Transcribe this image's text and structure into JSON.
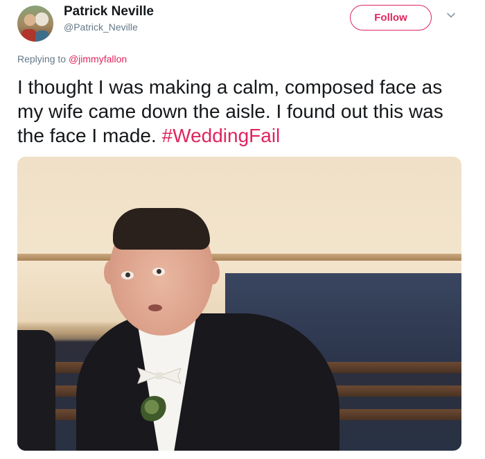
{
  "author": {
    "name": "Patrick Neville",
    "handle": "@Patrick_Neville"
  },
  "actions": {
    "follow_label": "Follow"
  },
  "reply": {
    "prefix": "Replying to ",
    "mention": "@jimmyfallon"
  },
  "tweet": {
    "text": "I thought I was making a calm, composed face as my wife came down the aisle. I found out this was the face I made. ",
    "hashtag": "#WeddingFail"
  },
  "colors": {
    "accent": "#e0245e",
    "secondary_text": "#657786",
    "primary_text": "#14171a"
  },
  "icons": {
    "menu": "chevron-down-icon"
  }
}
